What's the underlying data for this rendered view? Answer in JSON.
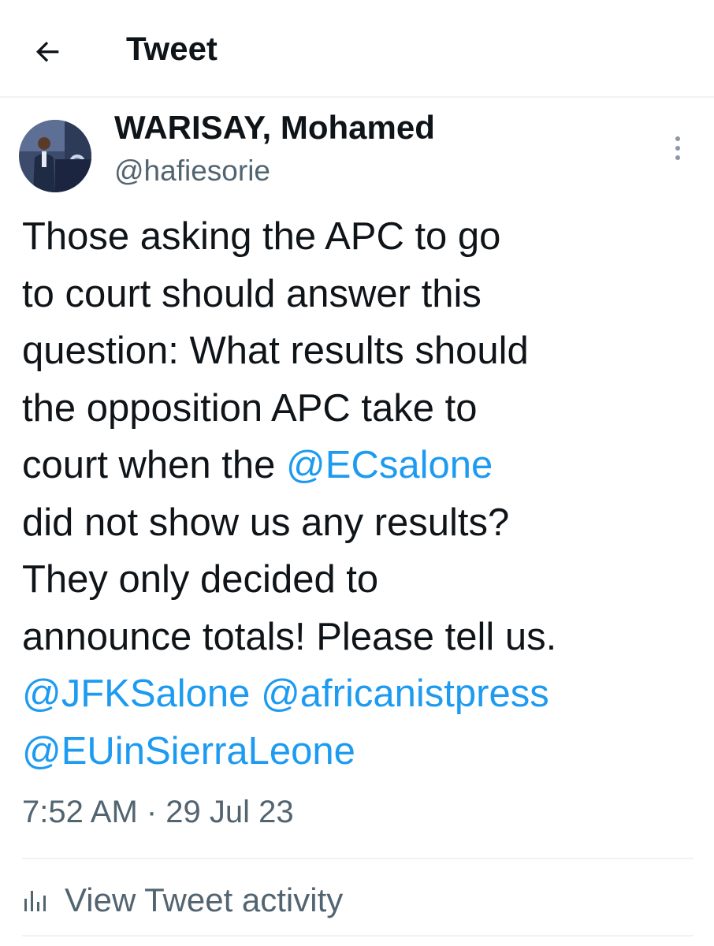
{
  "header": {
    "title": "Tweet",
    "back_icon": "arrow-left-icon"
  },
  "author": {
    "name": "WARISAY, Mohamed",
    "handle": "@hafiesorie",
    "more_icon": "more-vertical-icon"
  },
  "tweet": {
    "lines": [
      [
        {
          "text": "Those asking the APC to go",
          "mention": false
        }
      ],
      [
        {
          "text": "to court should answer this",
          "mention": false
        }
      ],
      [
        {
          "text": "question: What results should",
          "mention": false
        }
      ],
      [
        {
          "text": "the opposition APC take to",
          "mention": false
        }
      ],
      [
        {
          "text": "court when the ",
          "mention": false
        },
        {
          "text": "@ECsalone",
          "mention": true
        }
      ],
      [
        {
          "text": "did not show us any results?",
          "mention": false
        }
      ],
      [
        {
          "text": "They only decided to",
          "mention": false
        }
      ],
      [
        {
          "text": "announce totals! Please tell us.",
          "mention": false
        }
      ],
      [
        {
          "text": "@JFKSalone",
          "mention": true
        },
        {
          "text": " ",
          "mention": false
        },
        {
          "text": "@africanistpress",
          "mention": true
        }
      ],
      [
        {
          "text": "@EUinSierraLeone",
          "mention": true
        }
      ]
    ],
    "timestamp": "7:52 AM · 29 Jul 23"
  },
  "activity": {
    "label": "View Tweet activity",
    "icon": "analytics-bars-icon"
  },
  "colors": {
    "text": "#0f1419",
    "secondary": "#536471",
    "link": "#1d9bf0",
    "divider": "#eff3f4"
  }
}
